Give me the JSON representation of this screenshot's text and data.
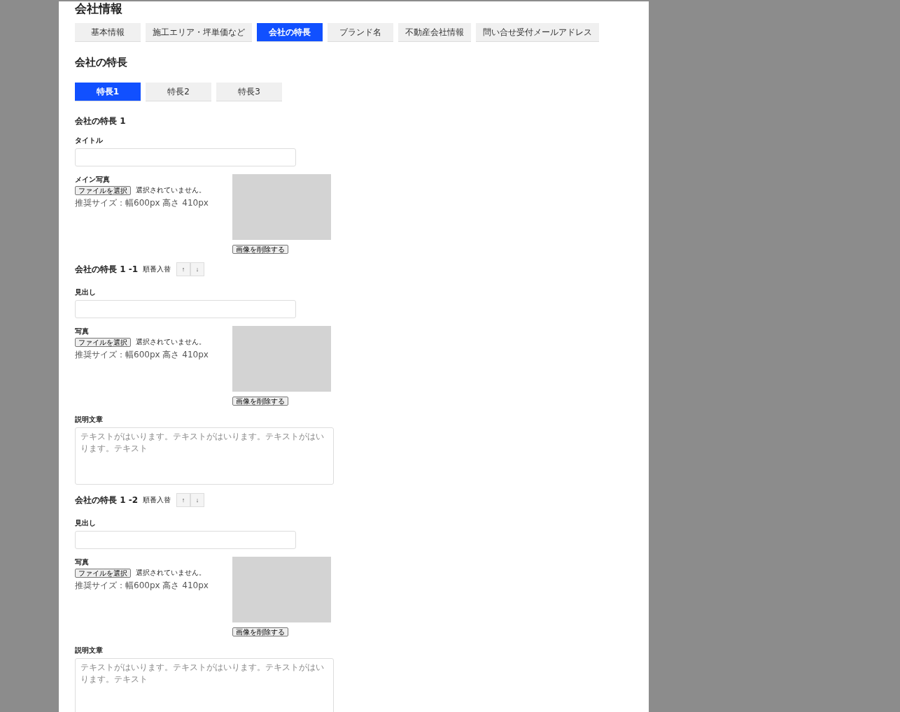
{
  "page_title": "会社情報",
  "tabs": [
    {
      "label": "基本情報",
      "selected": false
    },
    {
      "label": "施工エリア・坪単価など",
      "selected": false
    },
    {
      "label": "会社の特長",
      "selected": true
    },
    {
      "label": "ブランド名",
      "selected": false
    },
    {
      "label": "不動産会社情報",
      "selected": false
    },
    {
      "label": "問い合せ受付メールアドレス",
      "selected": false
    }
  ],
  "section_title": "会社の特長",
  "sub_tabs": [
    {
      "label": "特長1",
      "selected": true
    },
    {
      "label": "特長2",
      "selected": false
    },
    {
      "label": "特長3",
      "selected": false
    }
  ],
  "feature": {
    "heading": "会社の特長 1",
    "title_label": "タイトル",
    "photo": {
      "label": "メイン写真",
      "file_button": "ファイルを選択",
      "file_status": "選択されていません。",
      "hint": "推奨サイズ：幅600px 高さ 410px",
      "delete_button": "画像を削除する"
    }
  },
  "items": [
    {
      "heading": "会社の特長 1 -1",
      "reorder_label": "順番入替",
      "up": "↑",
      "down": "↓",
      "field_label": "見出し",
      "photo": {
        "label": "写真",
        "file_button": "ファイルを選択",
        "file_status": "選択されていません。",
        "hint": "推奨サイズ：幅600px 高さ 410px",
        "delete_button": "画像を削除する"
      },
      "description_label": "説明文章",
      "description_placeholder": "テキストがはいります。テキストがはいります。テキストがはいります。テキスト"
    },
    {
      "heading": "会社の特長 1 -2",
      "reorder_label": "順番入替",
      "up": "↑",
      "down": "↓",
      "field_label": "見出し",
      "photo": {
        "label": "写真",
        "file_button": "ファイルを選択",
        "file_status": "選択されていません。",
        "hint": "推奨サイズ：幅600px 高さ 410px",
        "delete_button": "画像を削除する"
      },
      "description_label": "説明文章",
      "description_placeholder": "テキストがはいります。テキストがはいります。テキストがはいります。テキスト"
    }
  ]
}
